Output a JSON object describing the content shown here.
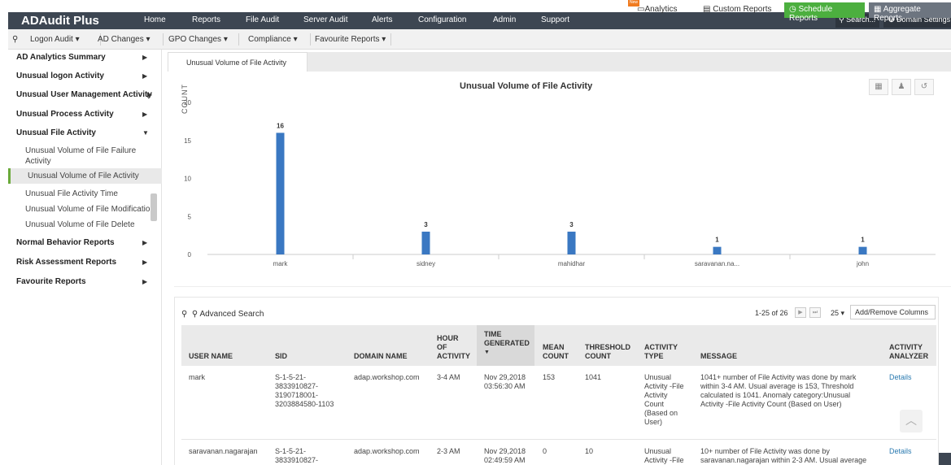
{
  "app": {
    "title": "ADAudit Plus"
  },
  "topnav": [
    "Home",
    "Reports",
    "File Audit",
    "Server Audit",
    "Alerts",
    "Configuration",
    "Admin",
    "Support"
  ],
  "topright": {
    "search": "Search...",
    "domain_settings": "Domain Settings"
  },
  "subnav": {
    "items": [
      "Logon Audit",
      "AD Changes",
      "GPO Changes",
      "Compliance",
      "Favourite Reports"
    ],
    "analytics": "Analytics",
    "new_badge": "New",
    "custom_reports": "Custom Reports",
    "schedule_reports": "Schedule Reports",
    "aggregate_reports": "Aggregate Reports"
  },
  "sidebar": {
    "sections": [
      "AD Analytics Summary",
      "Unusual logon Activity",
      "Unusual User Management Activity",
      "Unusual Process Activity",
      "Unusual File Activity",
      "Normal Behavior Reports",
      "Risk Assessment Reports",
      "Favourite Reports"
    ],
    "subitems": [
      "Unusual Volume of File Failure Activity",
      "Unusual Volume of File Activity",
      "Unusual File Activity Time",
      "Unusual Volume of File Modification",
      "Unusual Volume of File Delete"
    ]
  },
  "tab": {
    "label": "Unusual Volume of File Activity"
  },
  "chart_data": {
    "type": "bar",
    "title": "Unusual Volume of File Activity",
    "ylabel": "COUNT",
    "xlabel": "",
    "categories": [
      "mark",
      "sidney",
      "mahidhar",
      "saravanan.na...",
      "john"
    ],
    "values": [
      16,
      3,
      3,
      1,
      1
    ],
    "ylim": [
      0,
      20
    ],
    "yticks": [
      0,
      5,
      10,
      15,
      20
    ],
    "bar_color": "#3a78c2",
    "grid": false,
    "legend": "none"
  },
  "table": {
    "advanced_search": "Advanced Search",
    "pagination": "1-25 of 26",
    "per_page": "25",
    "add_remove": "Add/Remove Columns",
    "columns": {
      "user": "USER NAME",
      "sid": "SID",
      "domain": "DOMAIN NAME",
      "hour_1": "HOUR",
      "hour_2": "OF",
      "hour_3": "ACTIVITY",
      "time_1": "TIME",
      "time_2": "GENERATED",
      "mean_1": "MEAN",
      "mean_2": "COUNT",
      "thr_1": "THRESHOLD",
      "thr_2": "COUNT",
      "type_1": "ACTIVITY",
      "type_2": "TYPE",
      "message": "MESSAGE",
      "analyzer_1": "ACTIVITY",
      "analyzer_2": "ANALYZER"
    },
    "rows": [
      {
        "user": "mark",
        "sid": [
          "S-1-5-21-",
          "3833910827-",
          "3190718001-",
          "3203884580-1103"
        ],
        "domain": "adap.workshop.com",
        "hour": "3-4 AM",
        "time": [
          "Nov 29,2018",
          "03:56:30 AM"
        ],
        "mean": "153",
        "threshold": "1041",
        "type": [
          "Unusual",
          "Activity -File",
          "Activity",
          "Count",
          "(Based on",
          "User)"
        ],
        "message": [
          "1041+ number of File Activity was done by mark",
          "within 3-4 AM. Usual average is 153, Threshold",
          "calculated is 1041. Anomaly category:Unusual",
          "Activity -File Activity Count (Based on User)"
        ],
        "details": "Details"
      },
      {
        "user": "saravanan.nagarajan",
        "sid": [
          "S-1-5-21-",
          "3833910827-"
        ],
        "domain": "adap.workshop.com",
        "hour": "2-3 AM",
        "time": [
          "Nov 29,2018",
          "02:49:59 AM"
        ],
        "mean": "0",
        "threshold": "10",
        "type": [
          "Unusual",
          "Activity -File"
        ],
        "message": [
          "10+ number of File Activity was done by",
          "saravanan.nagarajan within 2-3 AM. Usual average"
        ],
        "details": "Details"
      }
    ]
  }
}
